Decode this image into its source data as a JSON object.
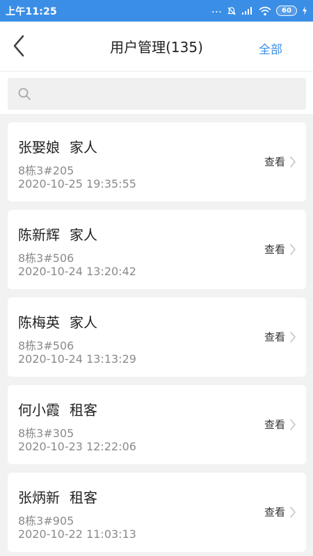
{
  "status_bar": {
    "time": "上午11:25",
    "battery": "60",
    "dots": "..."
  },
  "header": {
    "title": "用户管理(135)",
    "right_action": "全部",
    "back_icon": "chevron-left-icon"
  },
  "search": {
    "icon": "search-icon",
    "value": "",
    "placeholder": ""
  },
  "users": [
    {
      "name": "张娶娘",
      "role": "家人",
      "address": "8栋3#205",
      "time": "2020-10-25 19:35:55",
      "action": "查看"
    },
    {
      "name": "陈新辉",
      "role": "家人",
      "address": "8栋3#506",
      "time": "2020-10-24 13:20:42",
      "action": "查看"
    },
    {
      "name": "陈梅英",
      "role": "家人",
      "address": "8栋3#506",
      "time": "2020-10-24 13:13:29",
      "action": "查看"
    },
    {
      "name": "何小霞",
      "role": "租客",
      "address": "8栋3#305",
      "time": "2020-10-23 12:22:06",
      "action": "查看"
    },
    {
      "name": "张炳新",
      "role": "租客",
      "address": "8栋3#905",
      "time": "2020-10-22 11:03:13",
      "action": "查看"
    }
  ],
  "colors": {
    "status_bar_bg": "#3a8ee6",
    "accent": "#3a8ee6",
    "page_bg": "#f2f2f2"
  }
}
